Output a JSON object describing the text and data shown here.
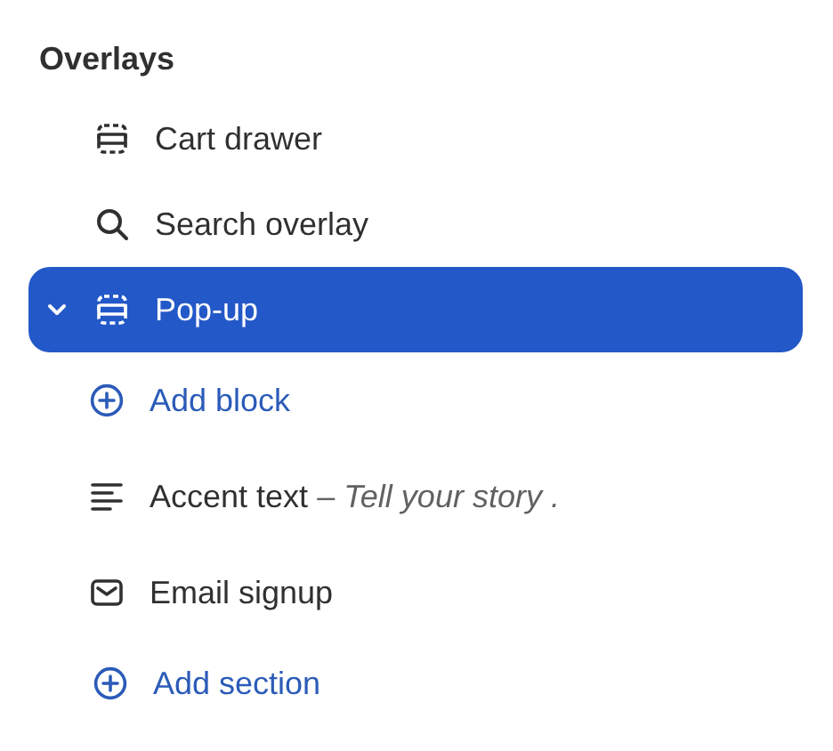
{
  "heading": "Overlays",
  "items": [
    {
      "kind": "overlay",
      "label": "Cart drawer",
      "selected": false
    },
    {
      "kind": "search",
      "label": "Search overlay",
      "selected": false
    },
    {
      "kind": "overlay",
      "label": "Pop-up",
      "selected": true,
      "expanded": true,
      "children": [
        {
          "kind": "add",
          "label": "Add block"
        },
        {
          "kind": "text",
          "label": "Accent text",
          "detail": "– *Tell your story .*"
        },
        {
          "kind": "email",
          "label": "Email signup"
        }
      ]
    }
  ],
  "add_section": {
    "label": "Add section"
  }
}
